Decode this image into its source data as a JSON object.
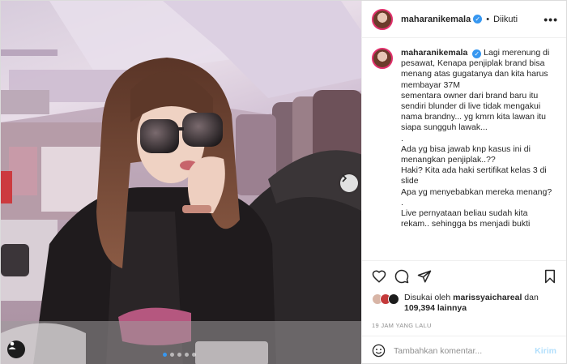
{
  "post": {
    "username": "maharanikemala",
    "verified_symbol": "✓",
    "separator": "•",
    "follow_label": "Diikuti",
    "more_label": "•••",
    "caption_lines": [
      "Lagi merenung di pesawat, Kenapa penjiplak brand bisa menang atas gugatanya dan kita harus membayar 37M",
      "sementara owner dari brand baru itu sendiri blunder di live tidak mengakui nama brandny... yg kmrn kita lawan itu siapa sungguh lawak...",
      ".",
      "Ada yg bisa jawab knp kasus ini di menangkan penjiplak..??",
      "Haki? Kita ada haki sertifikat kelas 3 di slide",
      "Apa yg menyebabkan mereka menang?",
      ".",
      "Live pernyataan beliau sudah kita rekam.. sehingga bs menjadi bukti"
    ],
    "likes_prefix": "Disukai oleh",
    "likes_user": "marissyaichareal",
    "likes_mid": "dan",
    "likes_count": "109,394",
    "likes_suffix": "lainnya",
    "timestamp": "19 JAM YANG LALU",
    "comment_placeholder": "Tambahkan komentar...",
    "post_button": "Kirim"
  },
  "icons": {
    "like": "heart-icon",
    "comment": "comment-icon",
    "share": "share-icon",
    "save": "bookmark-icon",
    "emoji": "emoji-icon",
    "next": "chevron-right-icon",
    "tag": "user-tag-icon"
  },
  "carousel": {
    "slide_count": 5,
    "active_index": 0
  },
  "colors": {
    "verified": "#3797f0",
    "post_button": "#b2dffc",
    "muted": "#8e8e8e"
  }
}
